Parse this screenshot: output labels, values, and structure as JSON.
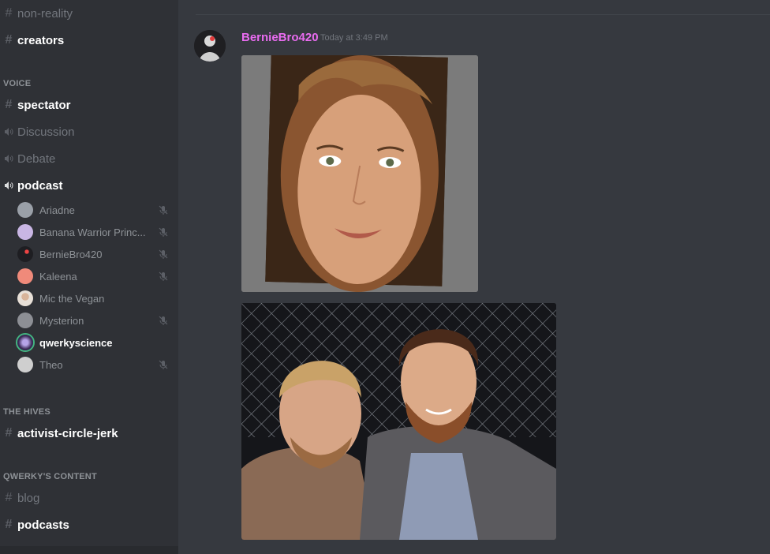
{
  "sidebar": {
    "text_channels_top": [
      {
        "label": "non-reality",
        "bright": false
      },
      {
        "label": "creators",
        "bright": true
      }
    ],
    "voice_category": "VOICE",
    "voice_channels": [
      {
        "label": "spectator",
        "icon": "hash-icon",
        "bright": true
      },
      {
        "label": "Discussion",
        "icon": "speaker-icon",
        "bright": false
      },
      {
        "label": "Debate",
        "icon": "speaker-icon",
        "bright": false
      },
      {
        "label": "podcast",
        "icon": "speaker-icon",
        "bright": true
      }
    ],
    "voice_users": [
      {
        "name": "Ariadne",
        "muted": true,
        "color": "#9aa0a8"
      },
      {
        "name": "Banana Warrior Princ...",
        "muted": true,
        "color": "#c9b6e4"
      },
      {
        "name": "BernieBro420",
        "muted": true,
        "color": "#1e1e22"
      },
      {
        "name": "Kaleena",
        "muted": true,
        "color": "#f08a7a"
      },
      {
        "name": "Mic the Vegan",
        "muted": false,
        "color": "#e8e0d8"
      },
      {
        "name": "Mysterion",
        "muted": true,
        "color": "#8d8f95"
      },
      {
        "name": "qwerkyscience",
        "muted": false,
        "color": "#6a4a8a",
        "live": true
      },
      {
        "name": "Theo",
        "muted": true,
        "color": "#cfcfcf"
      }
    ],
    "hives_category": "THE HIVES",
    "hives_channels": [
      {
        "label": "activist-circle-jerk",
        "icon": "locked-hash-icon",
        "bright": true
      }
    ],
    "content_category": "QWERKY'S CONTENT",
    "content_channels": [
      {
        "label": "blog",
        "bright": false
      },
      {
        "label": "podcasts",
        "bright": true
      }
    ]
  },
  "message": {
    "author": "BernieBro420",
    "author_color": "#e96cf0",
    "timestamp": "Today at 3:49 PM",
    "attachments": [
      "portrait-photo",
      "selfie-photo"
    ]
  },
  "colors": {
    "sidebar_bg": "#2f3136",
    "chat_bg": "#36393f",
    "muted_text": "#72767d",
    "online_green": "#43b581"
  }
}
